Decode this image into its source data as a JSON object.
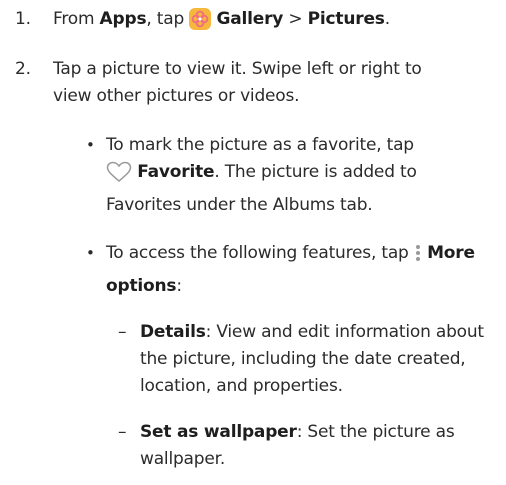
{
  "step1": {
    "number": "1.",
    "from": "From",
    "apps": "Apps",
    "tap": ", tap",
    "gallery_icon": "gallery-flower-icon",
    "gallery": "Gallery",
    "sep": ">",
    "pictures": "Pictures",
    "end": "."
  },
  "step2": {
    "number": "2.",
    "line1": "Tap a picture to view it. Swipe left or right to",
    "line2": "view other pictures or videos."
  },
  "bullet1": {
    "dot": "•",
    "line1": "To mark the picture as a favorite, tap",
    "heart_icon": "heart-outline-icon",
    "favorite": "Favorite",
    "line2_rest": ". The picture is added to",
    "line3": "Favorites under the Albums tab."
  },
  "bullet2": {
    "dot": "•",
    "line1_pre": "To access the following features, tap",
    "more_icon": "vertical-dots-icon",
    "more": "More",
    "options": "options",
    "colon": ":"
  },
  "details": {
    "mark": "–",
    "title": "Details",
    "line1_rest": ": View and edit information about",
    "line2": "the picture, including the date created,",
    "line3": "location, and properties."
  },
  "wallpaper": {
    "mark": "–",
    "title": "Set as wallpaper",
    "line1_rest": ": Set the picture as",
    "line2": "wallpaper."
  },
  "colors": {
    "text": "#2b2b2b",
    "gallery_icon_bg": "#f6b73c",
    "gallery_icon_petal": "#f06b86",
    "icon_gray": "#9a9a9a"
  }
}
